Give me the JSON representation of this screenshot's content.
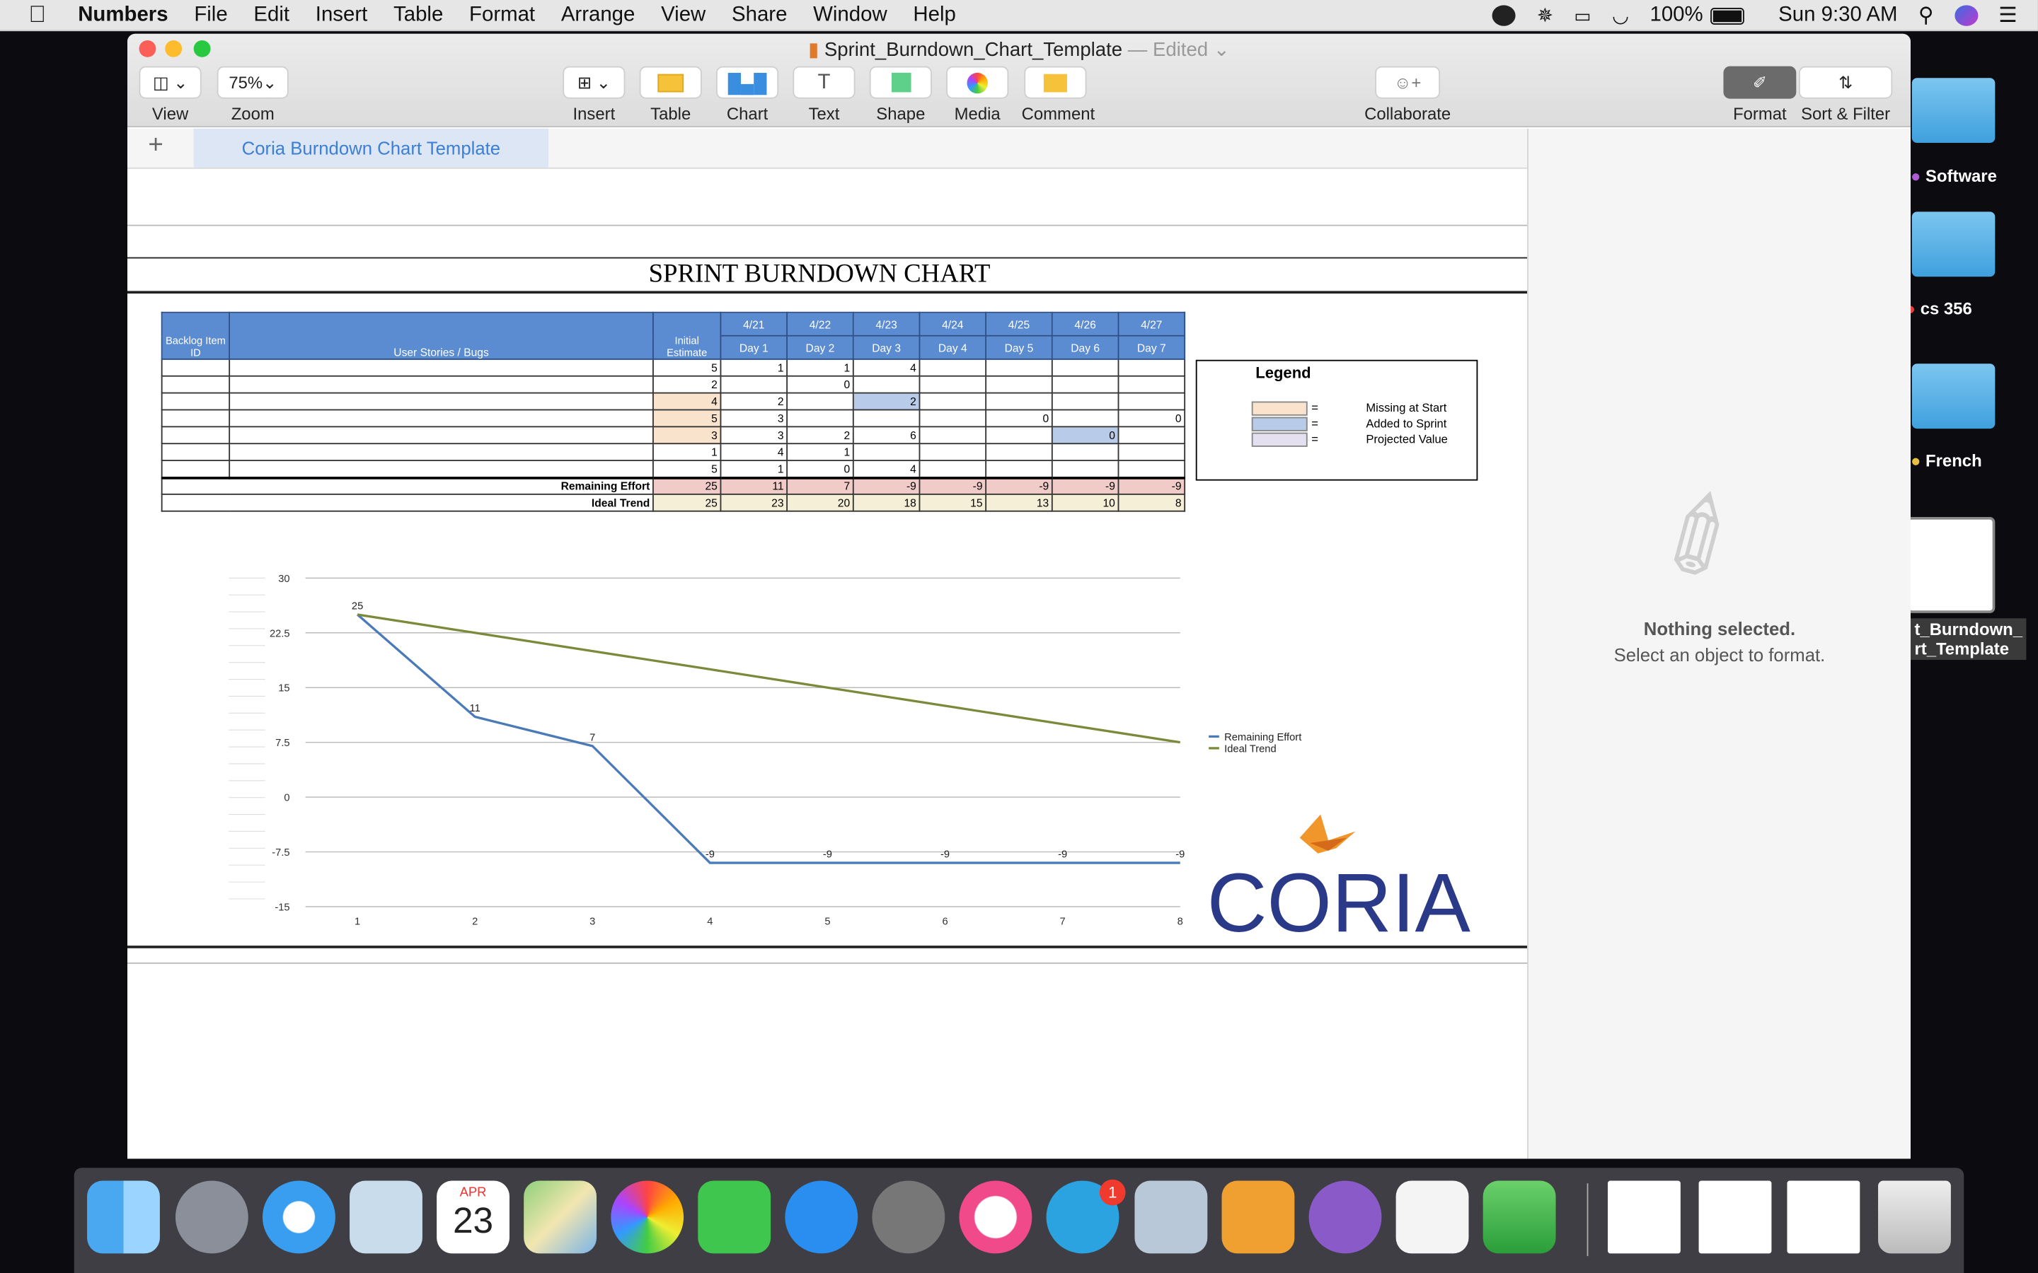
{
  "menubar": {
    "app": "Numbers",
    "items": [
      "File",
      "Edit",
      "Insert",
      "Table",
      "Format",
      "Arrange",
      "View",
      "Share",
      "Window",
      "Help"
    ],
    "battery": "100%",
    "clock": "Sun 9:30 AM"
  },
  "window": {
    "title": "Sprint_Burndown_Chart_Template",
    "edited": "— Edited",
    "zoom": "75%",
    "toolbar": {
      "view": "View",
      "zoom": "Zoom",
      "insert": "Insert",
      "table": "Table",
      "chart": "Chart",
      "text": "Text",
      "shape": "Shape",
      "media": "Media",
      "comment": "Comment",
      "collaborate": "Collaborate",
      "format": "Format",
      "sort_filter": "Sort & Filter"
    },
    "sheet_tab": "Coria Burndown Chart Template"
  },
  "sheet": {
    "title": "SPRINT BURNDOWN CHART",
    "header": {
      "backlog": "Backlog Item ID",
      "stories": "User Stories / Bugs",
      "initial": "Initial Estimate",
      "dates": [
        "4/21",
        "4/22",
        "4/23",
        "4/24",
        "4/25",
        "4/26",
        "4/27"
      ],
      "days": [
        "Day 1",
        "Day 2",
        "Day 3",
        "Day 4",
        "Day 5",
        "Day 6",
        "Day 7"
      ]
    },
    "rows": [
      [
        "5",
        "1",
        "1",
        "4",
        "",
        "",
        "",
        ""
      ],
      [
        "2",
        "",
        "0",
        "",
        "",
        "",
        "",
        ""
      ],
      [
        "4",
        "2",
        "",
        "2",
        "",
        "",
        "",
        ""
      ],
      [
        "5",
        "3",
        "",
        "",
        "",
        "0",
        "",
        "0"
      ],
      [
        "3",
        "3",
        "2",
        "6",
        "",
        "",
        "0",
        ""
      ],
      [
        "1",
        "4",
        "1",
        "",
        "",
        "",
        "",
        ""
      ],
      [
        "5",
        "1",
        "0",
        "4",
        "",
        "",
        "",
        ""
      ]
    ],
    "remaining_label": "Remaining Effort",
    "remaining": [
      "25",
      "11",
      "7",
      "-9",
      "-9",
      "-9",
      "-9",
      "-9"
    ],
    "ideal_label": "Ideal Trend",
    "ideal": [
      "25",
      "23",
      "20",
      "18",
      "15",
      "13",
      "10",
      "8"
    ],
    "legend": {
      "title": "Legend",
      "items": [
        {
          "eq": "=",
          "label": "Missing at Start",
          "color": "#fae3cc"
        },
        {
          "eq": "=",
          "label": "Added to Sprint",
          "color": "#b8cbe8"
        },
        {
          "eq": "=",
          "label": "Projected Value",
          "color": "#e4e0f0"
        }
      ]
    },
    "logo": "CORIA"
  },
  "chart_data": {
    "type": "line",
    "x": [
      1,
      2,
      3,
      4,
      5,
      6,
      7,
      8
    ],
    "series": [
      {
        "name": "Remaining Effort",
        "values": [
          25,
          11,
          7,
          -9,
          -9,
          -9,
          -9,
          -9
        ],
        "color": "#4a7ab8"
      },
      {
        "name": "Ideal Trend",
        "values": [
          25,
          22.5,
          20,
          17.5,
          15,
          12.5,
          10,
          7.5
        ],
        "color": "#7a8a3a"
      }
    ],
    "point_labels": [
      "25",
      "11",
      "7",
      "-9",
      "-9",
      "-9",
      "-9",
      "-9"
    ],
    "y_ticks": [
      "30",
      "22.5",
      "15",
      "7.5",
      "0",
      "-7.5",
      "-15"
    ],
    "ylim": [
      -15,
      30
    ],
    "grid": true,
    "legend_position": "right"
  },
  "sidebar": {
    "nothing": "Nothing selected.",
    "hint": "Select an object to format."
  },
  "desktop": {
    "labels": [
      "Software",
      "cs 356",
      "French",
      "t_Burndown_",
      "rt_Template"
    ]
  },
  "dock": {
    "calendar_month": "APR",
    "calendar_day": "23",
    "telegram_badge": "1"
  }
}
